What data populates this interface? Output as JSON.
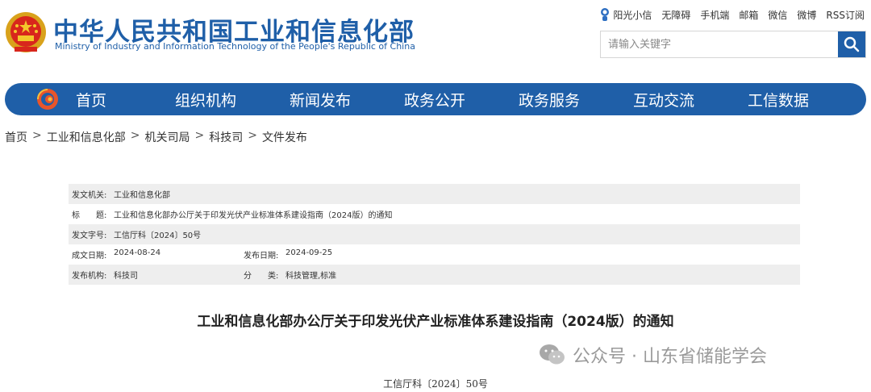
{
  "header": {
    "site_name": "中华人民共和国工业和信息化部",
    "site_name_en": "Ministry of Industry and Information Technology of the People's Republic of China",
    "top_links": [
      "阳光小信",
      "无障碍",
      "手机端",
      "邮箱",
      "微信",
      "微博",
      "RSS订阅"
    ],
    "search_placeholder": "请输入关键字",
    "brand_color": "#1f5fa8"
  },
  "nav": {
    "items": [
      "首页",
      "组织机构",
      "新闻发布",
      "政务公开",
      "政务服务",
      "互动交流",
      "工信数据"
    ]
  },
  "breadcrumb": {
    "items": [
      "首页",
      "工业和信息化部",
      "机关司局",
      "科技司",
      "文件发布"
    ],
    "separator": ">"
  },
  "meta": {
    "issuer_label": "发文机关:",
    "issuer": "工业和信息化部",
    "title_label": "标　　题:",
    "title": "工业和信息化部办公厅关于印发光伏产业标准体系建设指南（2024版）的通知",
    "doc_no_label": "发文字号:",
    "doc_no": "工信厅科〔2024〕50号",
    "created_label": "成文日期:",
    "created": "2024-08-24",
    "published_label": "发布日期:",
    "published": "2024-09-25",
    "org_label": "发布机构:",
    "org": "科技司",
    "category_label": "分　　类:",
    "category": "科技管理,标准"
  },
  "document": {
    "title": "工业和信息化部办公厅关于印发光伏产业标准体系建设指南（2024版）的通知",
    "doc_no": "工信厅科〔2024〕50号"
  },
  "watermark": {
    "text": "公众号 · 山东省储能学会"
  }
}
